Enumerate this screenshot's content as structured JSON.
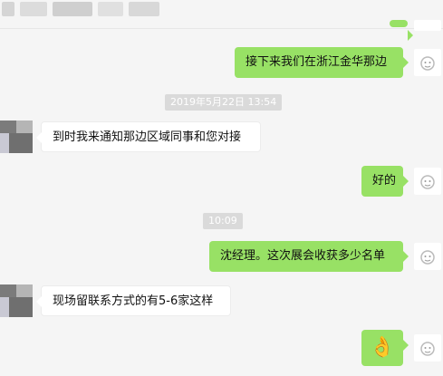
{
  "messages": [
    {
      "id": "m1",
      "side": "right",
      "text": "接下来我们在浙江金华那边"
    },
    {
      "id": "ts1",
      "type": "timestamp",
      "text": "2019年5月22日 13:54"
    },
    {
      "id": "m2",
      "side": "left",
      "text": "到时我来通知那边区域同事和您对接"
    },
    {
      "id": "m3",
      "side": "right",
      "text": "好的"
    },
    {
      "id": "ts2",
      "type": "timestamp",
      "text": "10:09"
    },
    {
      "id": "m4",
      "side": "right",
      "text": "沈经理。这次展会收获多少名单"
    },
    {
      "id": "m5",
      "side": "left",
      "text": "现场留联系方式的有5-6家这样"
    },
    {
      "id": "m6",
      "side": "right",
      "emoji": "ok-hand",
      "text": "👌"
    }
  ],
  "colors": {
    "background": "#f5f5f5",
    "outgoing_bubble": "#98e165",
    "incoming_bubble": "#ffffff",
    "timestamp_bg": "#dadada"
  }
}
